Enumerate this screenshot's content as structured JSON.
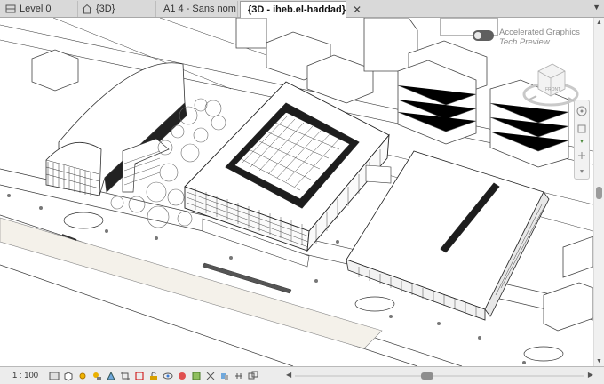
{
  "tabs": [
    {
      "label": "Level 0",
      "icon": "floor-plan-icon",
      "active": false
    },
    {
      "label": "{3D}",
      "icon": "home-3d-icon",
      "active": false
    },
    {
      "label": "A1 4 - Sans nom",
      "icon": "sheet-icon",
      "active": false
    },
    {
      "label": "{3D - iheb.el-haddad}",
      "icon": "home-3d-icon",
      "active": true
    }
  ],
  "tab_close_glyph": "✕",
  "accelerated_graphics": {
    "line1": "Accelerated Graphics",
    "line2": "Tech Preview",
    "enabled": false
  },
  "viewcube": {
    "face_label": "FRONT"
  },
  "statusbar": {
    "scale": "1 : 100",
    "icons": [
      "detail-level-icon",
      "visual-style-icon",
      "sun-path-icon",
      "shadows-icon",
      "show-rendering-icon",
      "crop-view-icon",
      "show-crop-region-icon",
      "unlock-3d-view-icon",
      "temporary-hide-icon",
      "reveal-hidden-icon",
      "temporary-view-properties-icon",
      "analytical-model-icon",
      "highlight-displacement-icon",
      "reveal-constraints-icon",
      "worksharing-display-icon"
    ]
  },
  "colors": {
    "line": "#3a3a3a",
    "tab_bg": "#d9d9d9",
    "status_bg": "#ececec",
    "road": "#f4f1ea"
  }
}
